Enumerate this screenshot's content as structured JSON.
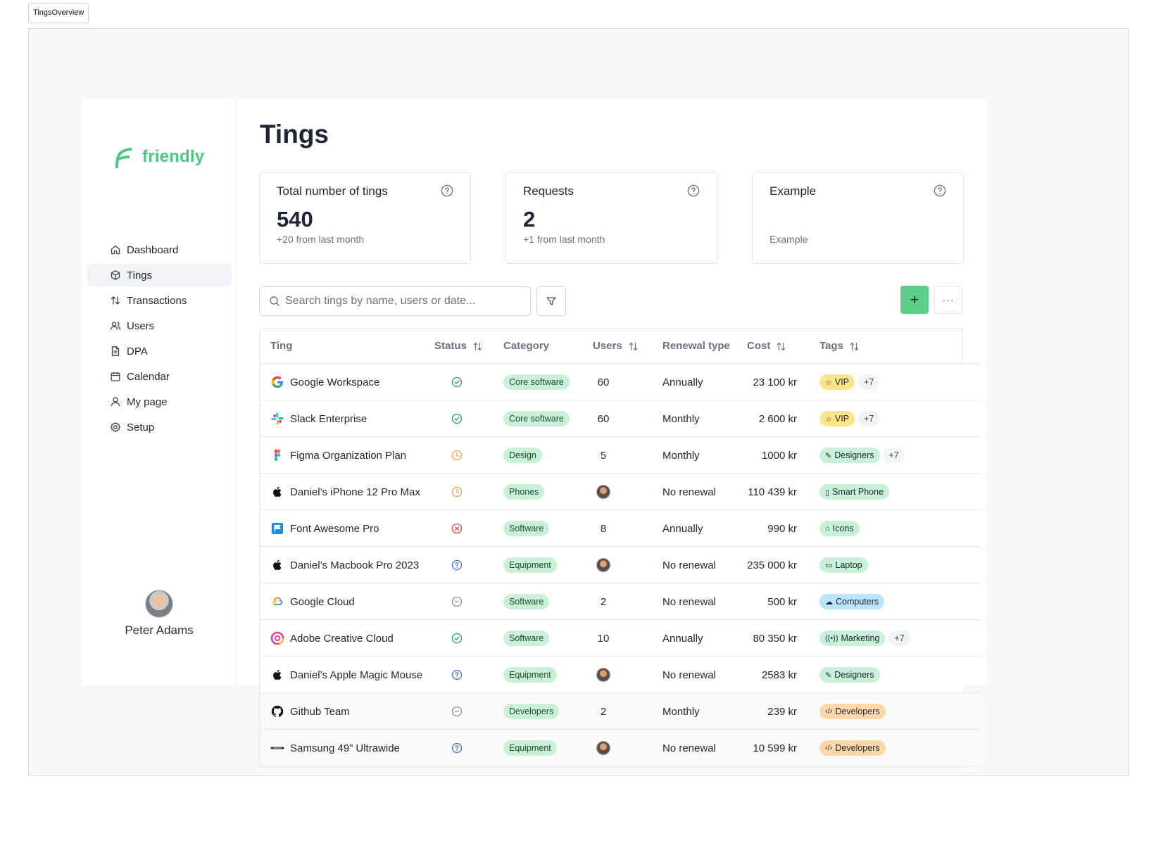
{
  "frame_label": "TingsOverview",
  "brand": {
    "name": "friendly",
    "color": "#4cc87f"
  },
  "nav": [
    {
      "label": "Dashboard",
      "icon": "home-icon",
      "active": false
    },
    {
      "label": "Tings",
      "icon": "box-icon",
      "active": true
    },
    {
      "label": "Transactions",
      "icon": "arrows-updown-icon",
      "active": false
    },
    {
      "label": "Users",
      "icon": "users-icon",
      "active": false
    },
    {
      "label": "DPA",
      "icon": "document-icon",
      "active": false
    },
    {
      "label": "Calendar",
      "icon": "calendar-icon",
      "active": false
    },
    {
      "label": "My page",
      "icon": "user-icon",
      "active": false
    },
    {
      "label": "Setup",
      "icon": "gear-icon",
      "active": false
    }
  ],
  "profile": {
    "name": "Peter Adams"
  },
  "page": {
    "title": "Tings"
  },
  "cards": [
    {
      "title": "Total number of tings",
      "value": "540",
      "sub": "+20 from last month"
    },
    {
      "title": "Requests",
      "value": "2",
      "sub": "+1 from last month"
    },
    {
      "title": "Example",
      "value": "",
      "sub": "Example"
    }
  ],
  "search": {
    "placeholder": "Search tings by name, users or date..."
  },
  "actions": {
    "add": "+",
    "more": "···"
  },
  "table": {
    "headers": {
      "ting": "Ting",
      "status": "Status",
      "category": "Category",
      "users": "Users",
      "renewal": "Renewal type",
      "cost": "Cost",
      "tags": "Tags"
    },
    "rows": [
      {
        "name": "Google Workspace",
        "logo": "google-icon",
        "status": "active",
        "category": "Core software",
        "users": "60",
        "renewal": "Annually",
        "cost": "23 100 kr",
        "tags": [
          {
            "label": "VIP",
            "icon": "star-icon",
            "color": "yellow"
          }
        ],
        "more": "+7"
      },
      {
        "name": "Slack Enterprise",
        "logo": "slack-icon",
        "status": "active",
        "category": "Core software",
        "users": "60",
        "renewal": "Monthly",
        "cost": "2 600 kr",
        "tags": [
          {
            "label": "VIP",
            "icon": "star-icon",
            "color": "yellow"
          }
        ],
        "more": "+7"
      },
      {
        "name": "Figma Organization Plan",
        "logo": "figma-icon",
        "status": "pending",
        "category": "Design",
        "users": "5",
        "renewal": "Monthly",
        "cost": "1000 kr",
        "tags": [
          {
            "label": "Designers",
            "icon": "pen-icon",
            "color": "green"
          }
        ],
        "more": "+7"
      },
      {
        "name": "Daniel’s iPhone 12 Pro Max",
        "logo": "apple-icon",
        "status": "pending",
        "category": "Phones",
        "users": "",
        "avatar": true,
        "renewal": "No renewal",
        "cost": "110 439 kr",
        "tags": [
          {
            "label": "Smart Phone",
            "icon": "phone-icon",
            "color": "green"
          }
        ],
        "more": ""
      },
      {
        "name": "Font Awesome Pro",
        "logo": "fontawesome-icon",
        "status": "cancelled",
        "category": "Software",
        "users": "8",
        "renewal": "Annually",
        "cost": "990 kr",
        "tags": [
          {
            "label": "Icons",
            "icon": "tag-icon",
            "color": "green"
          }
        ],
        "more": ""
      },
      {
        "name": "Daniel’s Macbook Pro 2023",
        "logo": "apple-icon",
        "status": "unknown",
        "category": "Equipment",
        "users": "",
        "avatar": true,
        "renewal": "No renewal",
        "cost": "235 000 kr",
        "tags": [
          {
            "label": "Laptop",
            "icon": "laptop-icon",
            "color": "green"
          }
        ],
        "more": ""
      },
      {
        "name": "Google Cloud",
        "logo": "google-cloud-icon",
        "status": "inactive",
        "category": "Software",
        "users": "2",
        "renewal": "No renewal",
        "cost": "500 kr",
        "tags": [
          {
            "label": "Computers",
            "icon": "cloud-icon",
            "color": "blue"
          }
        ],
        "more": ""
      },
      {
        "name": "Adobe Creative Cloud",
        "logo": "adobe-cc-icon",
        "status": "active",
        "category": "Software",
        "users": "10",
        "renewal": "Annually",
        "cost": "80 350 kr",
        "tags": [
          {
            "label": "Marketing",
            "icon": "broadcast-icon",
            "color": "green"
          }
        ],
        "more": "+7"
      },
      {
        "name": "Daniel’s Apple Magic Mouse",
        "logo": "apple-icon",
        "status": "unknown",
        "category": "Equipment",
        "users": "",
        "avatar": true,
        "renewal": "No renewal",
        "cost": "2583 kr",
        "tags": [
          {
            "label": "Designers",
            "icon": "pen-icon",
            "color": "green"
          }
        ],
        "more": ""
      },
      {
        "name": "Github Team",
        "logo": "github-icon",
        "status": "inactive",
        "category": "Developers",
        "users": "2",
        "renewal": "Monthly",
        "cost": "239 kr",
        "tags": [
          {
            "label": "Developers",
            "icon": "code-icon",
            "color": "orange"
          }
        ],
        "more": ""
      },
      {
        "name": "Samsung 49” Ultrawide",
        "logo": "samsung-icon",
        "status": "unknown",
        "category": "Equipment",
        "users": "",
        "avatar": true,
        "renewal": "No renewal",
        "cost": "10 599 kr",
        "tags": [
          {
            "label": "Developers",
            "icon": "code-icon",
            "color": "orange"
          }
        ],
        "more": ""
      }
    ]
  },
  "colors": {
    "accent": "#5dcf8a",
    "status_active": "#22a55a",
    "status_pending": "#f59e42",
    "status_cancelled": "#e0443e",
    "status_unknown": "#3b6fe0",
    "status_inactive": "#8a8f98"
  }
}
